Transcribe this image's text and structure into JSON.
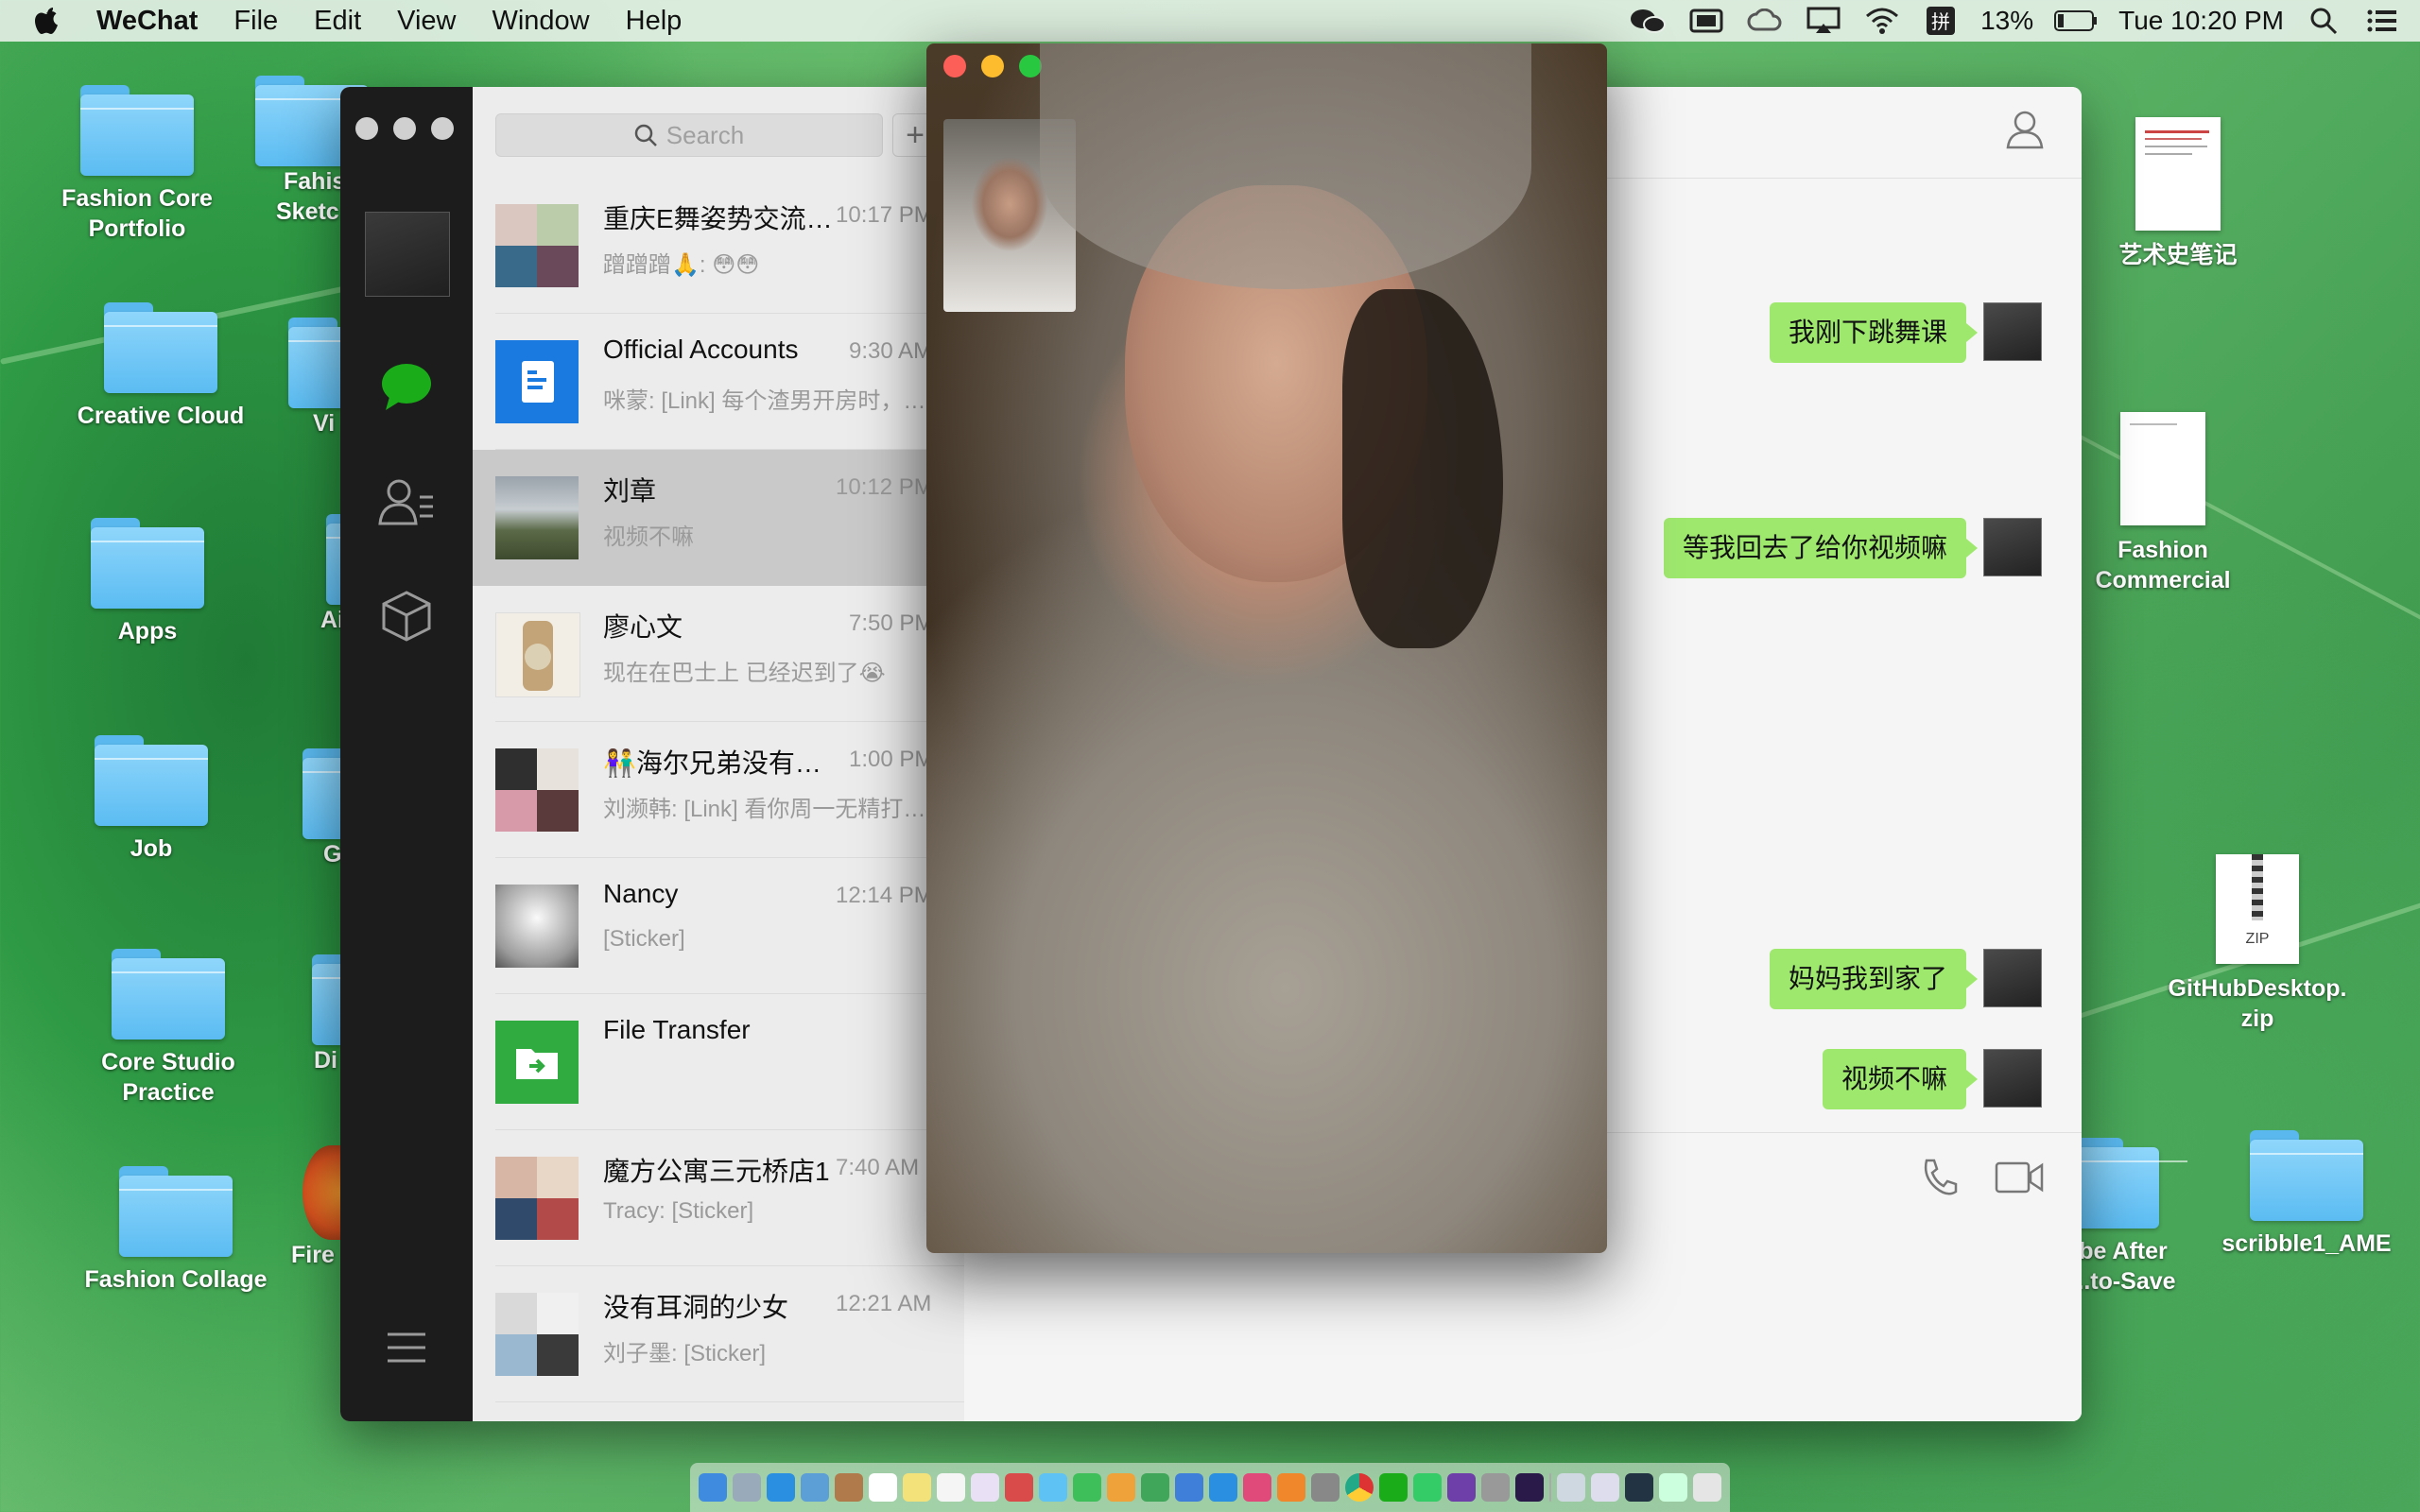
{
  "menubar": {
    "app_name": "WeChat",
    "menus": [
      "File",
      "Edit",
      "View",
      "Window",
      "Help"
    ],
    "battery": "13%",
    "clock": "Tue 10:20 PM"
  },
  "desktop": {
    "icons_left": [
      {
        "label": "Fashion Core\nPortfolio"
      },
      {
        "label": "Creative Cloud"
      },
      {
        "label": "Apps"
      },
      {
        "label": "Job"
      },
      {
        "label": "Core Studio\nPractice"
      },
      {
        "label": "Fashion Collage"
      }
    ],
    "icons_left_partial": [
      "Fahis",
      "Sketc",
      "Vi",
      "Ai",
      "G",
      "Di",
      "Fire"
    ],
    "icons_right": [
      {
        "label": "艺术史笔记"
      },
      {
        "label": "Fashion\nCommercial"
      },
      {
        "label": "GitHubDesktop.\nzip",
        "badge": "ZIP"
      },
      {
        "label": "be After\n...to-Save"
      },
      {
        "label": "scribble1_AME"
      }
    ]
  },
  "wechat": {
    "search_placeholder": "Search",
    "add_button": "+",
    "chats": [
      {
        "name": "重庆E舞姿势交流…",
        "time": "10:17 PM",
        "preview": "蹭蹭蹭🙏: 😳😳",
        "selected": false
      },
      {
        "name": "Official Accounts",
        "time": "9:30 AM",
        "preview": "咪蒙: [Link] 每个渣男开房时，…",
        "selected": false
      },
      {
        "name": "刘章",
        "time": "10:12 PM",
        "preview": "视频不嘛",
        "selected": true
      },
      {
        "name": "廖心文",
        "time": "7:50 PM",
        "preview": "现在在巴士上 已经迟到了😭",
        "selected": false
      },
      {
        "name": "👫海尔兄弟没有…",
        "time": "1:00 PM",
        "preview": "刘濒韩: [Link] 看你周一无精打…",
        "selected": false
      },
      {
        "name": "Nancy",
        "time": "12:14 PM",
        "preview": "[Sticker]",
        "selected": false
      },
      {
        "name": "File Transfer",
        "time": "",
        "preview": "",
        "selected": false
      },
      {
        "name": "魔方公寓三元桥店1",
        "time": "7:40 AM",
        "preview": "Tracy: [Sticker]",
        "selected": false
      },
      {
        "name": "没有耳洞的少女",
        "time": "12:21 AM",
        "preview": "刘子墨: [Sticker]",
        "selected": false
      }
    ],
    "messages": [
      {
        "text": "我刚下跳舞课",
        "from": "me"
      },
      {
        "text": "等我回去了给你视频嘛",
        "from": "me"
      },
      {
        "text": "妈妈我到家了",
        "from": "me"
      },
      {
        "text": "视频不嘛",
        "from": "me"
      }
    ]
  },
  "colors": {
    "wechat_green": "#1aad19",
    "bubble_green": "#9fe86e",
    "official_blue": "#1a7ae0",
    "file_transfer_green": "#2fab3f"
  }
}
